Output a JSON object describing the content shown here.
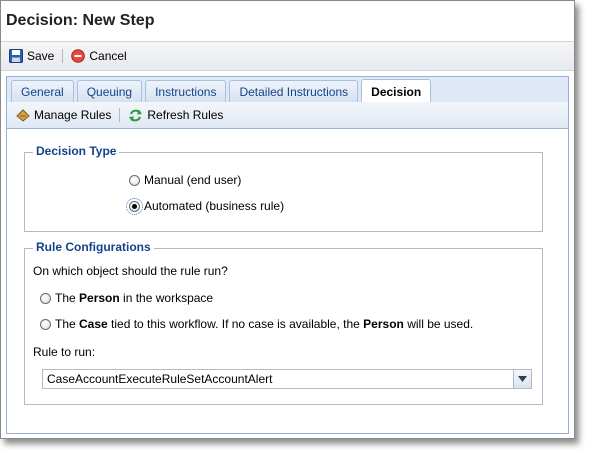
{
  "window": {
    "title": "Decision: New Step"
  },
  "toolbar": {
    "save_label": "Save",
    "cancel_label": "Cancel"
  },
  "tabs": [
    {
      "label": "General"
    },
    {
      "label": "Queuing"
    },
    {
      "label": "Instructions"
    },
    {
      "label": "Detailed Instructions"
    },
    {
      "label": "Decision"
    }
  ],
  "active_tab": "Decision",
  "subtoolbar": {
    "manage_label": "Manage Rules",
    "refresh_label": "Refresh Rules"
  },
  "decision_type": {
    "legend": "Decision Type",
    "options": [
      {
        "label": "Manual (end user)",
        "checked": false
      },
      {
        "label": "Automated (business rule)",
        "checked": true
      }
    ]
  },
  "rule_config": {
    "legend": "Rule Configurations",
    "question": "On which object should the rule run?",
    "opt1": {
      "pre": "The ",
      "bold": "Person",
      "post": " in the workspace"
    },
    "opt2": {
      "pre": "The ",
      "bold1": "Case",
      "mid": " tied to this workflow. If no case is available, the ",
      "bold2": "Person",
      "post": " will be used."
    },
    "rule_label": "Rule to run:",
    "rule_value": "CaseAccountExecuteRuleSetAccountAlert"
  }
}
